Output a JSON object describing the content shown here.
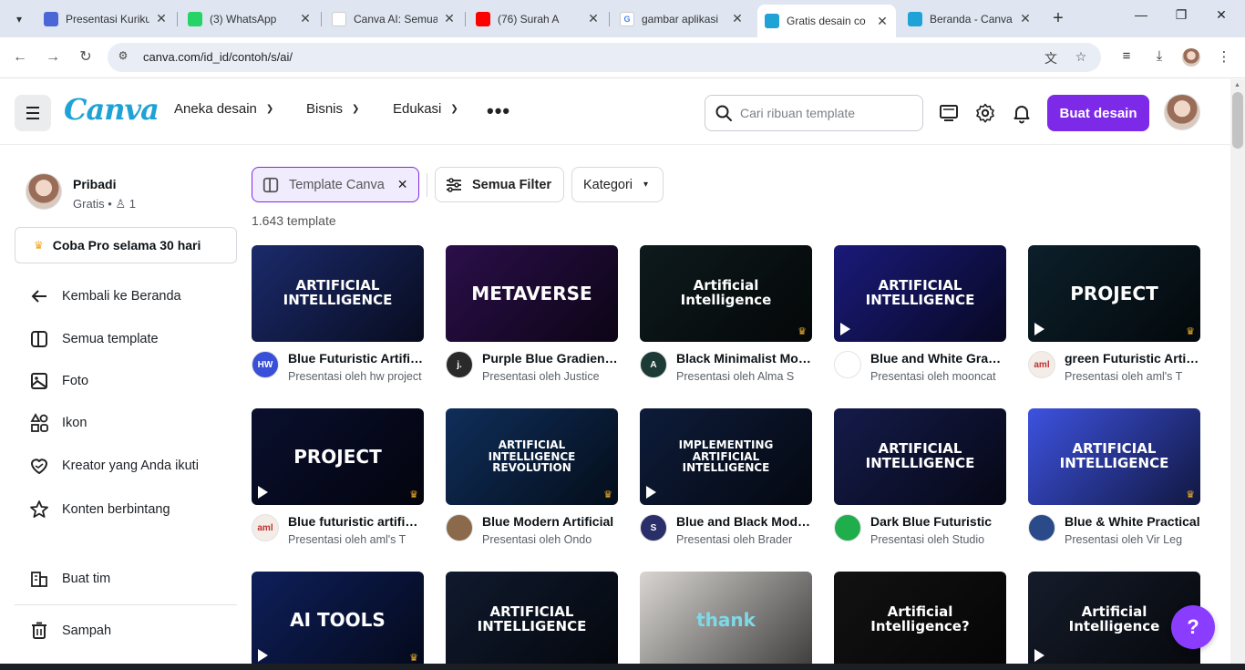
{
  "browser": {
    "tabs": [
      {
        "title": "Presentasi Kurikulum",
        "favicon_color": "#4b67d6",
        "favicon_glyph": "",
        "close": "✕"
      },
      {
        "title": "(3) WhatsApp",
        "favicon_color": "#25d366",
        "favicon_glyph": "",
        "close": "✕"
      },
      {
        "title": "Canva AI: Semua",
        "favicon_color": "#ffffff",
        "favicon_glyph": "",
        "close": "✕"
      },
      {
        "title": "(76) Surah A",
        "favicon_color": "#ff0000",
        "favicon_glyph": "",
        "close": "✕"
      },
      {
        "title": "gambar aplikasi",
        "favicon_color": "#ffffff",
        "favicon_glyph": "G",
        "close": "✕"
      },
      {
        "title": "Gratis desain co",
        "favicon_color": "#1fa2d6",
        "favicon_glyph": "",
        "close": "✕"
      },
      {
        "title": "Beranda - Canva",
        "favicon_color": "#1fa2d6",
        "favicon_glyph": "",
        "close": "✕"
      }
    ],
    "new_tab": "+",
    "url": "canva.com/id_id/contoh/s/ai/"
  },
  "header": {
    "logo": "Canva",
    "nav": [
      "Aneka desain",
      "Bisnis",
      "Edukasi"
    ],
    "more": "•••",
    "search_placeholder": "Cari ribuan template",
    "create_button": "Buat desain"
  },
  "sidebar": {
    "profile_name": "Pribadi",
    "profile_plan": "Gratis",
    "profile_members": "1",
    "pro_button": "Coba Pro selama 30 hari",
    "items": [
      {
        "label": "Kembali ke Beranda",
        "icon": "arrow-left-icon"
      },
      {
        "label": "Semua template",
        "icon": "template-icon"
      },
      {
        "label": "Foto",
        "icon": "photo-icon"
      },
      {
        "label": "Ikon",
        "icon": "shapes-icon"
      },
      {
        "label": "Kreator yang Anda ikuti",
        "icon": "heart-icon"
      },
      {
        "label": "Konten berbintang",
        "icon": "star-icon"
      },
      {
        "label": "Buat tim",
        "icon": "team-icon"
      },
      {
        "label": "Sampah",
        "icon": "trash-icon"
      }
    ]
  },
  "filters": {
    "template_chip": "Template Canva",
    "filter_button": "Semua Filter",
    "category": "Kategori",
    "count": "1.643 template"
  },
  "templates": [
    {
      "title": "Blue Futuristic Artificial Intelligence",
      "sub": "Presentasi oleh hw project",
      "thumb_text": "ARTIFICIAL INTELLIGENCE",
      "bg": "#1b2a6b",
      "avatar_text": "HW",
      "avatar_bg": "#3a4fd8",
      "premium": false,
      "video": false
    },
    {
      "title": "Purple Blue Gradient Metaverse",
      "sub": "Presentasi oleh Justice",
      "thumb_text": "METAVERSE",
      "bg": "#2b0f4a",
      "avatar_text": "j.",
      "avatar_bg": "#2a2a2a",
      "premium": false,
      "video": false
    },
    {
      "title": "Black Minimalist Modern AI",
      "sub": "Presentasi oleh Alma S",
      "thumb_text": "Artificial Intelligence",
      "bg": "#0e1a1c",
      "avatar_text": "A",
      "avatar_bg": "#1d3b36",
      "premium": true,
      "video": false
    },
    {
      "title": "Blue and White Gradient AI",
      "sub": "Presentasi oleh mooncat",
      "thumb_text": "ARTIFICIAL INTELLIGENCE",
      "bg": "#1a1a7a",
      "avatar_text": "",
      "avatar_bg": "#ffffff",
      "premium": false,
      "video": true
    },
    {
      "title": "green Futuristic Artificial",
      "sub": "Presentasi oleh aml's T",
      "thumb_text": "PROJECT",
      "bg": "#0c1f2a",
      "avatar_text": "aml",
      "avatar_bg": "#f3ece7",
      "premium": true,
      "video": true
    },
    {
      "title": "Blue futuristic artificial",
      "sub": "Presentasi oleh aml's T",
      "thumb_text": "PROJECT",
      "bg": "#0a0f2e",
      "avatar_text": "aml",
      "avatar_bg": "#f3ece7",
      "premium": true,
      "video": true
    },
    {
      "title": "Blue Modern Artificial",
      "sub": "Presentasi oleh Ondo",
      "thumb_text": "ARTIFICIAL INTELLIGENCE REVOLUTION",
      "bg": "#0f2e5a",
      "avatar_text": "",
      "avatar_bg": "#8a6a4a",
      "premium": true,
      "video": false
    },
    {
      "title": "Blue and Black Modern",
      "sub": "Presentasi oleh Brader",
      "thumb_text": "IMPLEMENTING ARTIFICIAL INTELLIGENCE",
      "bg": "#0e1c3a",
      "avatar_text": "S",
      "avatar_bg": "#2a2f6a",
      "premium": false,
      "video": true
    },
    {
      "title": "Dark Blue Futuristic",
      "sub": "Presentasi oleh Studio",
      "thumb_text": "ARTIFICIAL INTELLIGENCE",
      "bg": "#151b4a",
      "avatar_text": "",
      "avatar_bg": "#1fae4b",
      "premium": false,
      "video": false
    },
    {
      "title": "Blue & White Practical",
      "sub": "Presentasi oleh Vir Leg",
      "thumb_text": "ARTIFICIAL INTELLIGENCE",
      "bg": "#3d52e0",
      "avatar_text": "",
      "avatar_bg": "#2a4a8a",
      "premium": true,
      "video": false
    },
    {
      "title": "",
      "sub": "",
      "thumb_text": "AI TOOLS",
      "bg": "#0e1f5a",
      "avatar_text": "",
      "avatar_bg": "#ffffff",
      "premium": true,
      "video": true
    },
    {
      "title": "",
      "sub": "",
      "thumb_text": "ARTIFICIAL INTELLIGENCE",
      "bg": "#101a2e",
      "avatar_text": "",
      "avatar_bg": "#ffffff",
      "premium": false,
      "video": false
    },
    {
      "title": "",
      "sub": "",
      "thumb_text": "thank",
      "bg": "#d9d6d2",
      "avatar_text": "",
      "avatar_bg": "#ffffff",
      "premium": false,
      "video": false
    },
    {
      "title": "",
      "sub": "",
      "thumb_text": "Artificial Intelligence?",
      "bg": "#121212",
      "avatar_text": "",
      "avatar_bg": "#ffffff",
      "premium": false,
      "video": false
    },
    {
      "title": "",
      "sub": "",
      "thumb_text": "Artificial Intelligence",
      "bg": "#151c2a",
      "avatar_text": "",
      "avatar_bg": "#ffffff",
      "premium": false,
      "video": true
    }
  ],
  "help": "?"
}
